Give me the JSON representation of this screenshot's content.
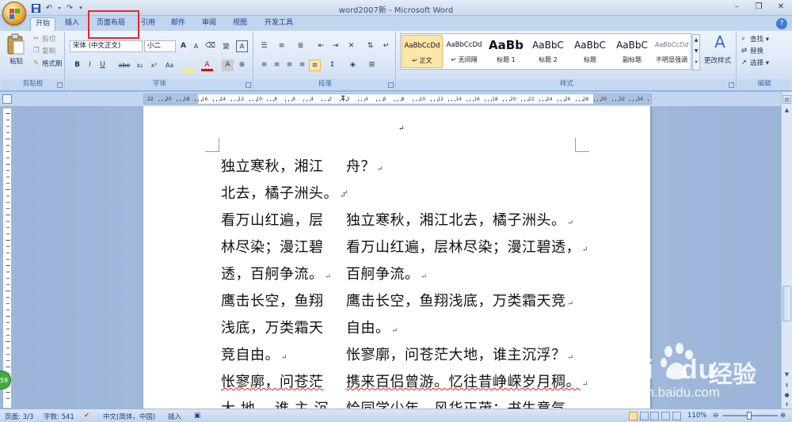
{
  "window": {
    "title": "word2007新 - Microsoft Word",
    "controls": [
      "–",
      "❐",
      "✕"
    ]
  },
  "tabs": [
    {
      "label": "开始",
      "active": true
    },
    {
      "label": "插入",
      "active": false
    },
    {
      "label": "页面布局",
      "active": false
    },
    {
      "label": "引用",
      "active": false
    },
    {
      "label": "邮件",
      "active": false
    },
    {
      "label": "审阅",
      "active": false
    },
    {
      "label": "视图",
      "active": false
    },
    {
      "label": "开发工具",
      "active": false
    }
  ],
  "ribbon": {
    "clipboard": {
      "label": "剪贴板",
      "paste": "粘贴",
      "cut": "剪切",
      "copy": "复制",
      "format_painter": "格式刷"
    },
    "font": {
      "label": "字体",
      "font_name": "宋体 (中文正文)",
      "font_size": "小二",
      "grow": "A",
      "shrink": "A",
      "bold": "B",
      "italic": "I",
      "underline": "U",
      "strike": "abe",
      "subscript": "x₂",
      "superscript": "x²",
      "change_case": "Aa",
      "clear_format": "A",
      "char_border": "A"
    },
    "paragraph": {
      "label": "段落"
    },
    "styles": {
      "label": "样式",
      "items": [
        {
          "sample": "AaBbCcDd",
          "name": "↵ 正文",
          "selected": true
        },
        {
          "sample": "AaBbCcDd",
          "name": "↵ 无间隔",
          "selected": false
        },
        {
          "sample": "AaBb",
          "name": "标题 1",
          "selected": false
        },
        {
          "sample": "AaBbC",
          "name": "标题 2",
          "selected": false
        },
        {
          "sample": "AaBbC",
          "name": "标题",
          "selected": false
        },
        {
          "sample": "AaBbC",
          "name": "副标题",
          "selected": false
        },
        {
          "sample": "AaBbCcDd",
          "name": "不明显强调",
          "selected": false
        }
      ],
      "change_styles": "更改样式"
    },
    "editing": {
      "label": "编辑",
      "find": "查找",
      "replace": "替换",
      "select": "选择"
    }
  },
  "ruler": {
    "ticks": [
      "22",
      "20",
      "18",
      "16",
      "14",
      "12",
      "10",
      "8",
      "6",
      "4",
      "2",
      "2",
      "4",
      "6",
      "8",
      "10",
      "12",
      "14",
      "16",
      "18",
      "20",
      "22",
      "24",
      "26",
      "28",
      "30",
      "32",
      "34"
    ]
  },
  "document": {
    "left_column": [
      "独立寒秋，湘江",
      "北去，橘子洲头。",
      "看万山红遍，层",
      "林尽染；漫江碧",
      "透，百舸争流。",
      "鹰击长空，鱼翔",
      "浅底，万类霜天",
      "竞自由。",
      "怅寥廓，问苍茫",
      "大 地， 谁 主 沉"
    ],
    "right_column": [
      "舟？",
      "",
      "独立寒秋，湘江北去，橘子洲头。",
      "看万山红遍，层林尽染；漫江碧透，",
      "百舸争流。",
      "鹰击长空，鱼翔浅底，万类霜天竞",
      "自由。",
      "怅寥廓，问苍茫大地，谁主沉浮？",
      "携来百侣曾游。忆往昔峥嵘岁月稠。",
      "恰同学少年，风华正茂；书生意气，"
    ]
  },
  "statusbar": {
    "page": "页面: 3/3",
    "words": "字数: 541",
    "language": "中文(简体，中国)",
    "mode": "插入",
    "zoom": "110%",
    "zoom_level": 1.1
  },
  "watermark": {
    "brand": "Bai",
    "brand_tail": "du",
    "cn": "经验",
    "url": "jingyan.baidu.com"
  },
  "badge": "59"
}
